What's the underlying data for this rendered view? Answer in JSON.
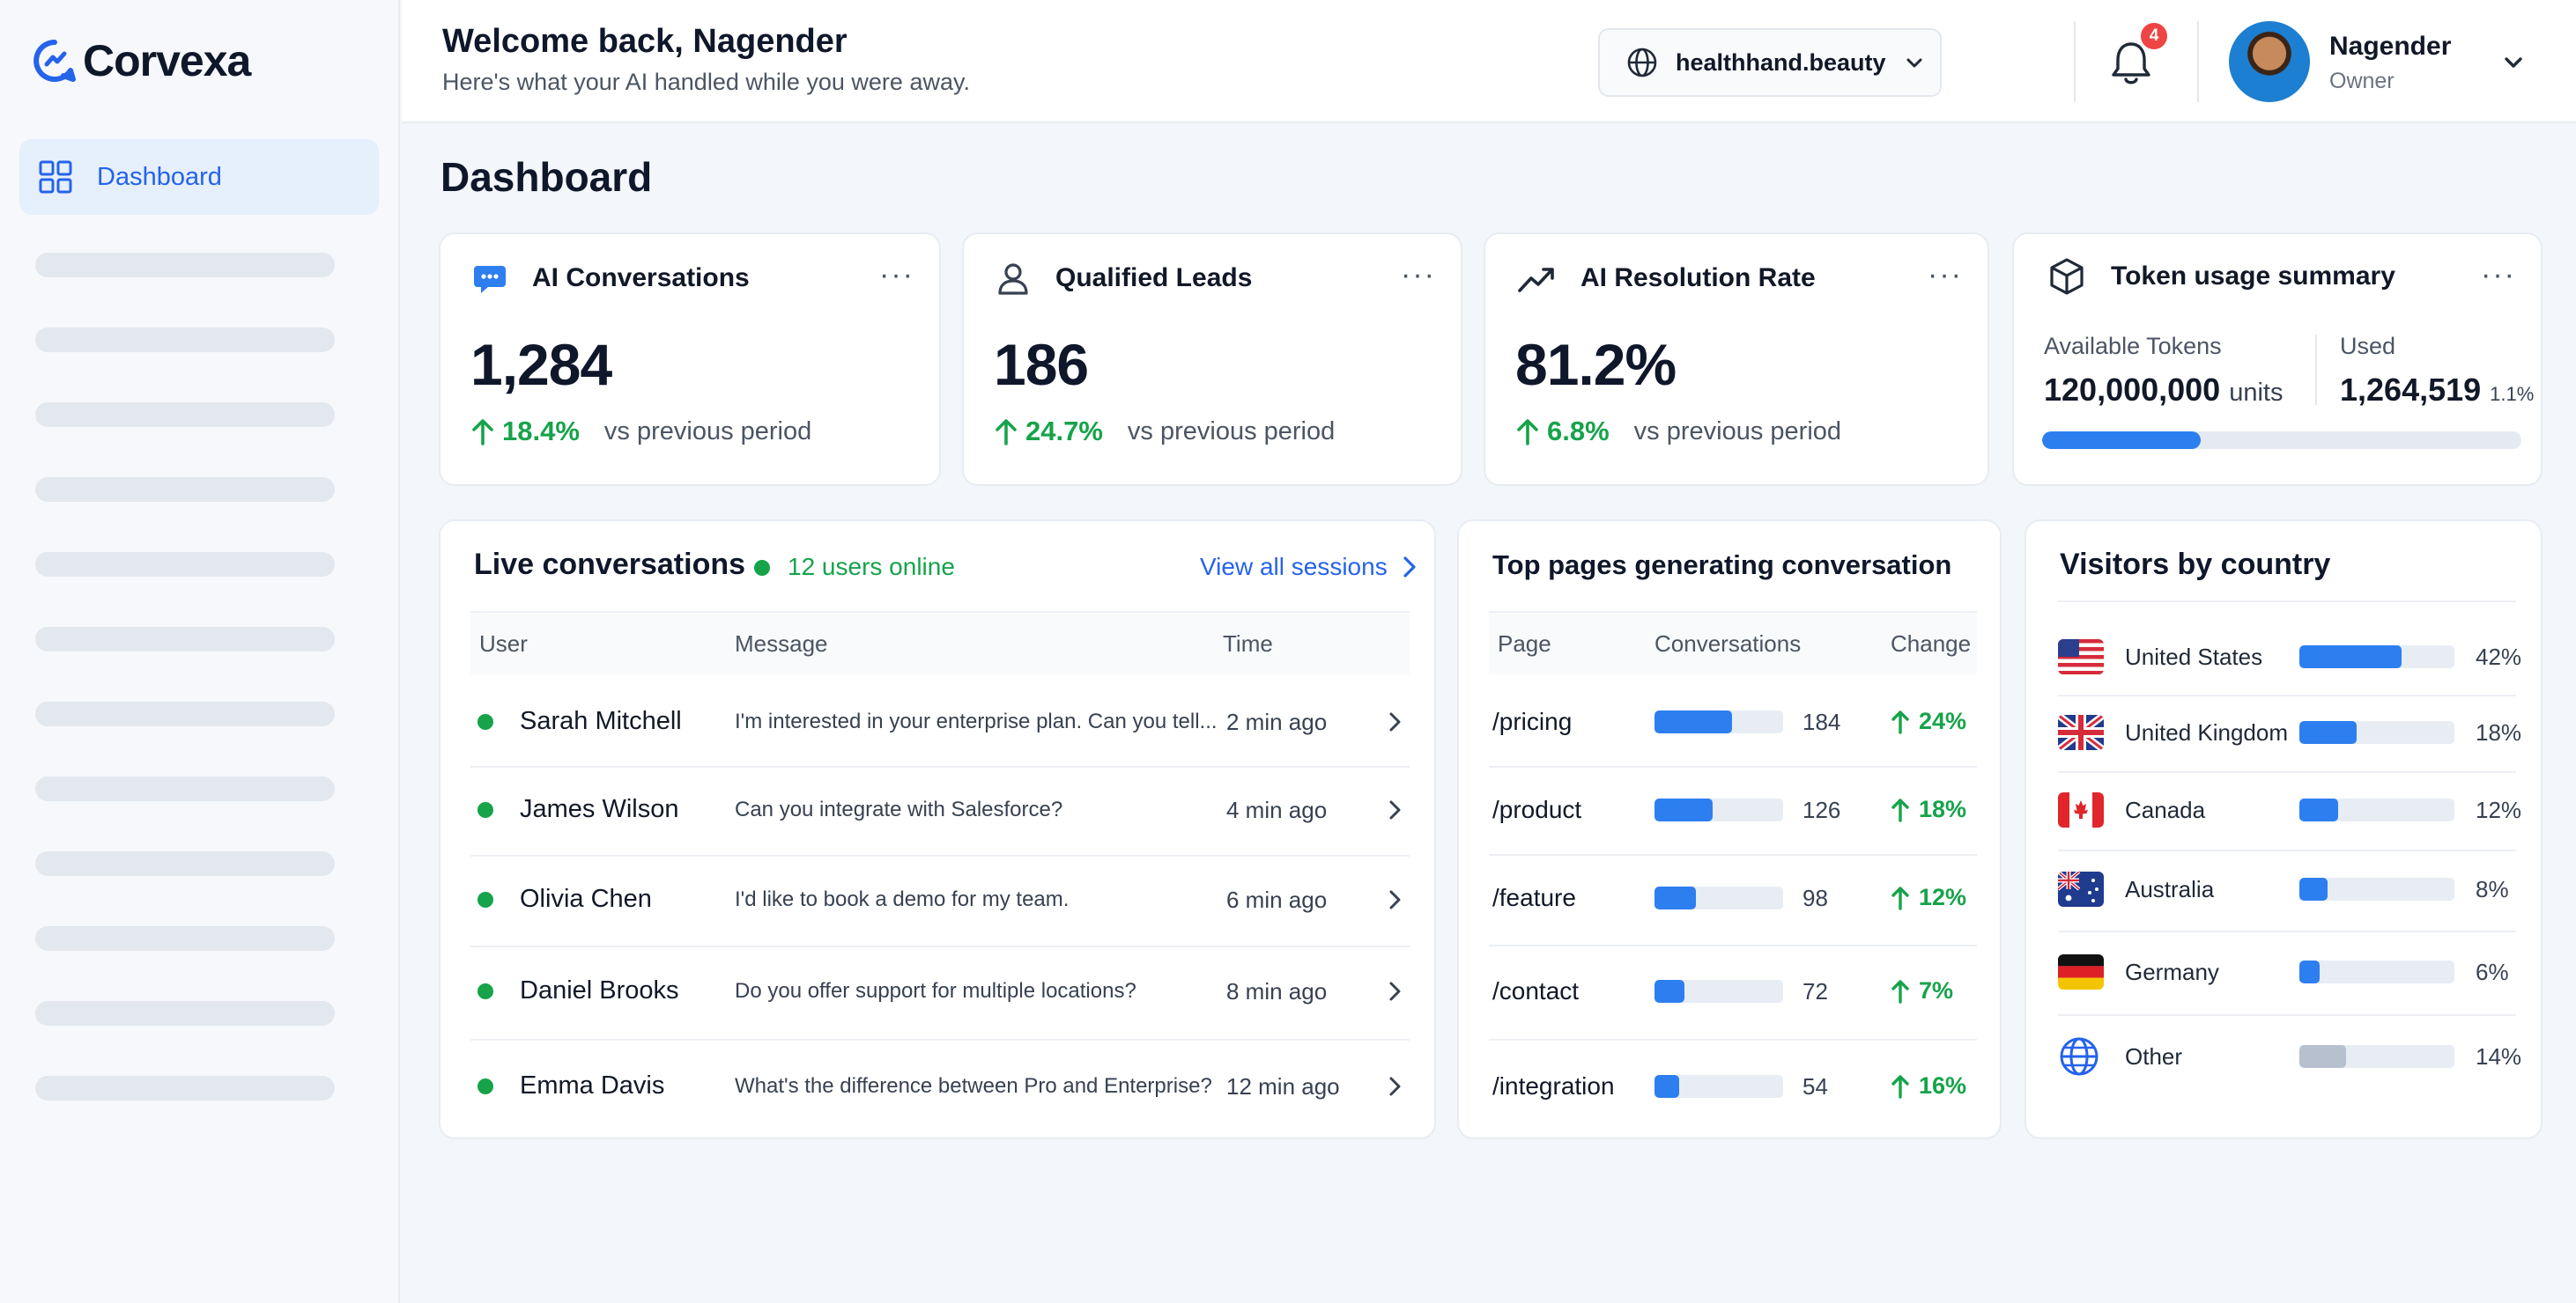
{
  "app": {
    "name": "Corvexa"
  },
  "sidebar": {
    "active_item": "Dashboard"
  },
  "header": {
    "welcome": "Welcome back, Nagender",
    "subtitle": "Here's what your AI handled while you were away.",
    "domain": "healthhand.beauty",
    "notification_count": "4",
    "user_name": "Nagender",
    "user_role": "Owner"
  },
  "page_title": "Dashboard",
  "kpis": [
    {
      "title": "AI Conversations",
      "value": "1,284",
      "change": "18.4%",
      "change_label": "vs previous period",
      "icon": "chat-bubble-icon"
    },
    {
      "title": "Qualified Leads",
      "value": "186",
      "change": "24.7%",
      "change_label": "vs previous period",
      "icon": "user-icon"
    },
    {
      "title": "AI Resolution Rate",
      "value": "81.2%",
      "change": "6.8%",
      "change_label": "vs previous period",
      "icon": "trend-up-icon"
    }
  ],
  "tokens": {
    "title": "Token usage summary",
    "available_label": "Available Tokens",
    "available_value": "120,000,000",
    "available_unit": "units",
    "used_label": "Used",
    "used_value": "1,264,519",
    "used_pct": "1.1%",
    "bar_fraction": 0.33
  },
  "live": {
    "title": "Live conversations",
    "online": "12 users online",
    "view_all": "View all sessions",
    "headers": [
      "User",
      "Message",
      "Time"
    ],
    "rows": [
      {
        "user": "Sarah Mitchell",
        "message": "I'm interested in your enterprise plan. Can you tell...",
        "time": "2 min ago"
      },
      {
        "user": "James Wilson",
        "message": "Can you integrate with Salesforce?",
        "time": "4 min ago"
      },
      {
        "user": "Olivia Chen",
        "message": "I'd like to book a demo for my team.",
        "time": "6 min ago"
      },
      {
        "user": "Daniel Brooks",
        "message": "Do you offer support for multiple locations?",
        "time": "8 min ago"
      },
      {
        "user": "Emma Davis",
        "message": "What's the difference between Pro and Enterprise?",
        "time": "12 min ago"
      }
    ]
  },
  "pages": {
    "title": "Top pages generating conversation",
    "headers": [
      "Page",
      "Conversations",
      "Change"
    ],
    "rows": [
      {
        "page": "/pricing",
        "conversations": "184",
        "change": "24%",
        "fraction": 0.6
      },
      {
        "page": "/product",
        "conversations": "126",
        "change": "18%",
        "fraction": 0.45
      },
      {
        "page": "/feature",
        "conversations": "98",
        "change": "12%",
        "fraction": 0.32
      },
      {
        "page": "/contact",
        "conversations": "72",
        "change": "7%",
        "fraction": 0.23
      },
      {
        "page": "/integration",
        "conversations": "54",
        "change": "16%",
        "fraction": 0.19
      }
    ]
  },
  "countries": {
    "title": "Visitors by country",
    "rows": [
      {
        "country": "United States",
        "pct": "42%",
        "fraction": 0.66,
        "flag": "us-flag-icon",
        "color": "#2d7ff0"
      },
      {
        "country": "United Kingdom",
        "pct": "18%",
        "fraction": 0.37,
        "flag": "uk-flag-icon",
        "color": "#2d7ff0"
      },
      {
        "country": "Canada",
        "pct": "12%",
        "fraction": 0.25,
        "flag": "canada-flag-icon",
        "color": "#2d7ff0"
      },
      {
        "country": "Australia",
        "pct": "8%",
        "fraction": 0.18,
        "flag": "australia-flag-icon",
        "color": "#2d7ff0"
      },
      {
        "country": "Germany",
        "pct": "6%",
        "fraction": 0.13,
        "flag": "germany-flag-icon",
        "color": "#2d7ff0"
      },
      {
        "country": "Other",
        "pct": "14%",
        "fraction": 0.3,
        "flag": "globe-icon",
        "color": "#b6c0cf"
      }
    ]
  }
}
